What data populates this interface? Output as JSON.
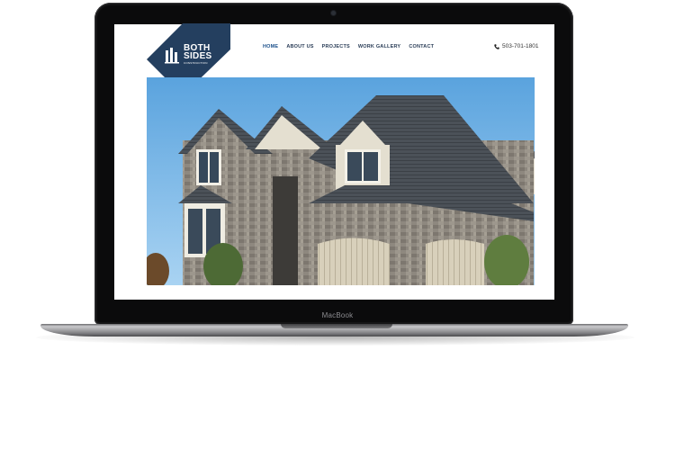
{
  "device": {
    "brand_label": "MacBook"
  },
  "site": {
    "logo": {
      "line1": "BOTH",
      "line2": "SIDES",
      "tagline": "CONSTRUCTION",
      "color": "#243f5f"
    },
    "nav": [
      {
        "label": "HOME",
        "active": true
      },
      {
        "label": "ABOUT US",
        "active": false
      },
      {
        "label": "PROJECTS",
        "active": false
      },
      {
        "label": "WORK GALLERY",
        "active": false
      },
      {
        "label": "CONTACT",
        "active": false
      }
    ],
    "phone": "503-701-1801",
    "phone_icon": "phone-icon"
  },
  "colors": {
    "sky": "#6fb0e4",
    "stone": "#8f8a82",
    "roof": "#4a5058",
    "trim": "#e6e1d3"
  }
}
